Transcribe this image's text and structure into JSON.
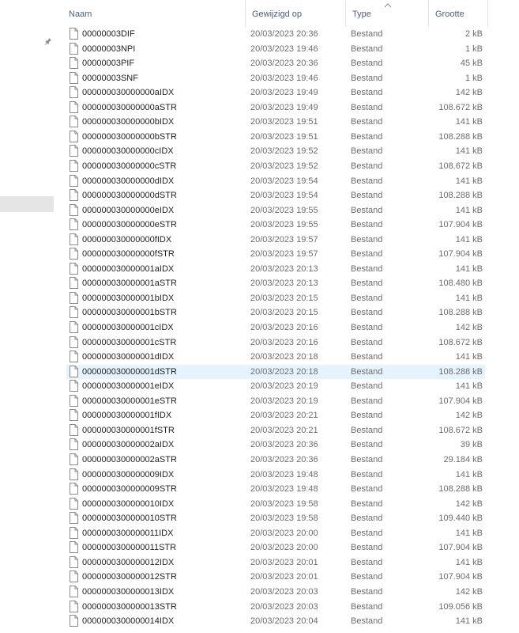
{
  "columns": {
    "name": "Naam",
    "modified": "Gewijzigd op",
    "type": "Type",
    "size": "Grootte"
  },
  "icons": {
    "pin": "pin-icon",
    "sort": "chevron-up-icon",
    "file": "file-icon"
  },
  "selected_index": 23,
  "files": [
    {
      "name": "00000003DIF",
      "modified": "20/03/2023 20:36",
      "type": "Bestand",
      "size": "2 kB"
    },
    {
      "name": "00000003NPI",
      "modified": "20/03/2023 19:46",
      "type": "Bestand",
      "size": "1 kB"
    },
    {
      "name": "00000003PIF",
      "modified": "20/03/2023 20:36",
      "type": "Bestand",
      "size": "45 kB"
    },
    {
      "name": "00000003SNF",
      "modified": "20/03/2023 19:46",
      "type": "Bestand",
      "size": "1 kB"
    },
    {
      "name": "000000030000000aIDX",
      "modified": "20/03/2023 19:49",
      "type": "Bestand",
      "size": "142 kB"
    },
    {
      "name": "000000030000000aSTR",
      "modified": "20/03/2023 19:49",
      "type": "Bestand",
      "size": "108.672 kB"
    },
    {
      "name": "000000030000000bIDX",
      "modified": "20/03/2023 19:51",
      "type": "Bestand",
      "size": "141 kB"
    },
    {
      "name": "000000030000000bSTR",
      "modified": "20/03/2023 19:51",
      "type": "Bestand",
      "size": "108.288 kB"
    },
    {
      "name": "000000030000000cIDX",
      "modified": "20/03/2023 19:52",
      "type": "Bestand",
      "size": "141 kB"
    },
    {
      "name": "000000030000000cSTR",
      "modified": "20/03/2023 19:52",
      "type": "Bestand",
      "size": "108.672 kB"
    },
    {
      "name": "000000030000000dIDX",
      "modified": "20/03/2023 19:54",
      "type": "Bestand",
      "size": "141 kB"
    },
    {
      "name": "000000030000000dSTR",
      "modified": "20/03/2023 19:54",
      "type": "Bestand",
      "size": "108.288 kB"
    },
    {
      "name": "000000030000000eIDX",
      "modified": "20/03/2023 19:55",
      "type": "Bestand",
      "size": "141 kB"
    },
    {
      "name": "000000030000000eSTR",
      "modified": "20/03/2023 19:55",
      "type": "Bestand",
      "size": "107.904 kB"
    },
    {
      "name": "000000030000000fIDX",
      "modified": "20/03/2023 19:57",
      "type": "Bestand",
      "size": "141 kB"
    },
    {
      "name": "000000030000000fSTR",
      "modified": "20/03/2023 19:57",
      "type": "Bestand",
      "size": "107.904 kB"
    },
    {
      "name": "000000030000001aIDX",
      "modified": "20/03/2023 20:13",
      "type": "Bestand",
      "size": "141 kB"
    },
    {
      "name": "000000030000001aSTR",
      "modified": "20/03/2023 20:13",
      "type": "Bestand",
      "size": "108.480 kB"
    },
    {
      "name": "000000030000001bIDX",
      "modified": "20/03/2023 20:15",
      "type": "Bestand",
      "size": "141 kB"
    },
    {
      "name": "000000030000001bSTR",
      "modified": "20/03/2023 20:15",
      "type": "Bestand",
      "size": "108.288 kB"
    },
    {
      "name": "000000030000001cIDX",
      "modified": "20/03/2023 20:16",
      "type": "Bestand",
      "size": "142 kB"
    },
    {
      "name": "000000030000001cSTR",
      "modified": "20/03/2023 20:16",
      "type": "Bestand",
      "size": "108.672 kB"
    },
    {
      "name": "000000030000001dIDX",
      "modified": "20/03/2023 20:18",
      "type": "Bestand",
      "size": "141 kB"
    },
    {
      "name": "000000030000001dSTR",
      "modified": "20/03/2023 20:18",
      "type": "Bestand",
      "size": "108.288 kB"
    },
    {
      "name": "000000030000001eIDX",
      "modified": "20/03/2023 20:19",
      "type": "Bestand",
      "size": "141 kB"
    },
    {
      "name": "000000030000001eSTR",
      "modified": "20/03/2023 20:19",
      "type": "Bestand",
      "size": "107.904 kB"
    },
    {
      "name": "000000030000001fIDX",
      "modified": "20/03/2023 20:21",
      "type": "Bestand",
      "size": "142 kB"
    },
    {
      "name": "000000030000001fSTR",
      "modified": "20/03/2023 20:21",
      "type": "Bestand",
      "size": "108.672 kB"
    },
    {
      "name": "000000030000002aIDX",
      "modified": "20/03/2023 20:36",
      "type": "Bestand",
      "size": "39 kB"
    },
    {
      "name": "000000030000002aSTR",
      "modified": "20/03/2023 20:36",
      "type": "Bestand",
      "size": "29.184 kB"
    },
    {
      "name": "0000000300000009IDX",
      "modified": "20/03/2023 19:48",
      "type": "Bestand",
      "size": "141 kB"
    },
    {
      "name": "0000000300000009STR",
      "modified": "20/03/2023 19:48",
      "type": "Bestand",
      "size": "108.288 kB"
    },
    {
      "name": "0000000300000010IDX",
      "modified": "20/03/2023 19:58",
      "type": "Bestand",
      "size": "142 kB"
    },
    {
      "name": "0000000300000010STR",
      "modified": "20/03/2023 19:58",
      "type": "Bestand",
      "size": "109.440 kB"
    },
    {
      "name": "0000000300000011IDX",
      "modified": "20/03/2023 20:00",
      "type": "Bestand",
      "size": "141 kB"
    },
    {
      "name": "0000000300000011STR",
      "modified": "20/03/2023 20:00",
      "type": "Bestand",
      "size": "107.904 kB"
    },
    {
      "name": "0000000300000012IDX",
      "modified": "20/03/2023 20:01",
      "type": "Bestand",
      "size": "141 kB"
    },
    {
      "name": "0000000300000012STR",
      "modified": "20/03/2023 20:01",
      "type": "Bestand",
      "size": "107.904 kB"
    },
    {
      "name": "0000000300000013IDX",
      "modified": "20/03/2023 20:03",
      "type": "Bestand",
      "size": "142 kB"
    },
    {
      "name": "0000000300000013STR",
      "modified": "20/03/2023 20:03",
      "type": "Bestand",
      "size": "109.056 kB"
    },
    {
      "name": "0000000300000014IDX",
      "modified": "20/03/2023 20:04",
      "type": "Bestand",
      "size": "141 kB"
    }
  ]
}
